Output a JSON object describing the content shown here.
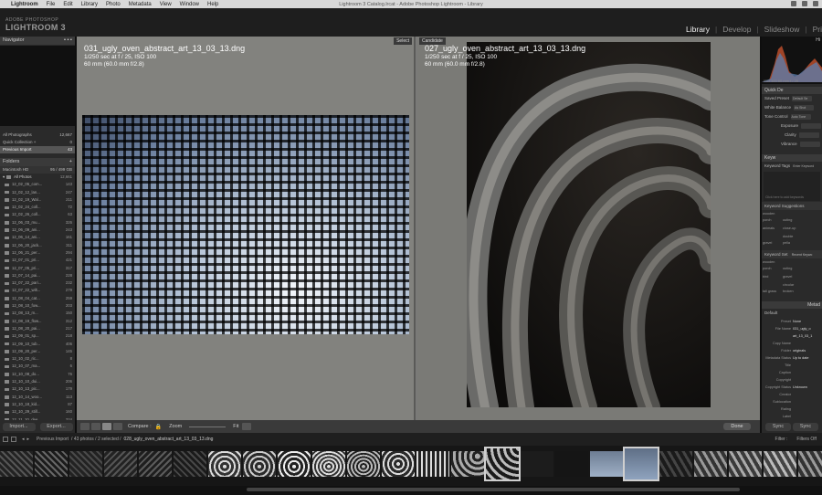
{
  "menubar": {
    "items": [
      "Lightroom",
      "File",
      "Edit",
      "Library",
      "Photo",
      "Metadata",
      "View",
      "Window",
      "Help"
    ],
    "window_title": "Lightroom 3 Catalog.lrcat - Adobe Photoshop Lightroom - Library"
  },
  "identity": {
    "brand_sub": "ADOBE PHOTOSHOP",
    "brand": "LIGHTROOM 3"
  },
  "modules": [
    "Library",
    "Develop",
    "Slideshow",
    "Pri"
  ],
  "left_panel": {
    "navigator_title": "Navigator",
    "catalog": [
      {
        "label": "All Photographs",
        "count": "12,667"
      },
      {
        "label": "Quick Collection +",
        "count": "0"
      },
      {
        "label": "Previous Import",
        "count": "43"
      }
    ],
    "folders_title": "Folders",
    "volume": {
      "label": "Macintosh HD",
      "info": "95 / 499 GB"
    },
    "root_folder": {
      "label": "All Photos",
      "count": "12,661"
    },
    "folders": [
      {
        "name": "12_02_05_com...",
        "count": "143"
      },
      {
        "name": "12_02_12_lan...",
        "count": "247"
      },
      {
        "name": "12_02_19_Wal...",
        "count": "211"
      },
      {
        "name": "12_02_24_coll...",
        "count": "72"
      },
      {
        "name": "12_02_26_coll...",
        "count": "63"
      },
      {
        "name": "12_06_03_mu...",
        "count": "326"
      },
      {
        "name": "12_06_09_ani...",
        "count": "243"
      },
      {
        "name": "12_06_14_ani...",
        "count": "161"
      },
      {
        "name": "12_06_20_jack...",
        "count": "311"
      },
      {
        "name": "12_06_21_per...",
        "count": "294"
      },
      {
        "name": "12_07_01_pri...",
        "count": "421"
      },
      {
        "name": "12_07_05_pri...",
        "count": "317"
      },
      {
        "name": "12_07_14_pai...",
        "count": "228"
      },
      {
        "name": "12_07_22_pari...",
        "count": "232"
      },
      {
        "name": "12_07_22_wilt...",
        "count": "279"
      },
      {
        "name": "12_08_04_cat...",
        "count": "259"
      },
      {
        "name": "12_08_10_fow...",
        "count": "203"
      },
      {
        "name": "12_08_13_m...",
        "count": "150"
      },
      {
        "name": "12_08_19_flow...",
        "count": "312"
      },
      {
        "name": "12_08_20_pai...",
        "count": "217"
      },
      {
        "name": "12_09_01_sp...",
        "count": "218"
      },
      {
        "name": "12_09_10_tub...",
        "count": "406"
      },
      {
        "name": "12_09_20_per...",
        "count": "145"
      },
      {
        "name": "12_10_02_ric...",
        "count": "8"
      },
      {
        "name": "12_10_07_ma...",
        "count": "6"
      },
      {
        "name": "12_10_08_do...",
        "count": "76"
      },
      {
        "name": "12_10_10_dui...",
        "count": "206"
      },
      {
        "name": "12_10_13_pic...",
        "count": "179"
      },
      {
        "name": "12_10_14_woo...",
        "count": "113"
      },
      {
        "name": "12_10_18_kid...",
        "count": "87"
      },
      {
        "name": "12_10_29_still...",
        "count": "160"
      },
      {
        "name": "12_11_10_dee...",
        "count": "324"
      },
      {
        "name": "12_11_17_but...",
        "count": "221"
      },
      {
        "name": "12_11_24_fall...",
        "count": "181"
      },
      {
        "name": "12_11_17_tub...",
        "count": "243"
      }
    ],
    "import_label": "Import...",
    "export_label": "Export..."
  },
  "compare": {
    "select_label": "Select",
    "candidate_label": "Candidate",
    "select_photo": {
      "filename": "031_ugly_oven_abstract_art_13_03_13.dng",
      "exposure": "1/250 sec at f / 25, ISO 100",
      "lens": "60 mm (60.0 mm f/2.8)"
    },
    "candidate_photo": {
      "filename": "027_ugly_oven_abstract_art_13_03_13.dng",
      "exposure": "1/250 sec at f / 25, ISO 100",
      "lens": "60 mm (60.0 mm f/2.8)"
    }
  },
  "toolbar": {
    "compare_label": "Compare :",
    "zoom_label": "Zoom",
    "fit_label": "Fit",
    "done_label": "Done"
  },
  "right_panel": {
    "histogram_title": "Hi",
    "histogram_readout": "ISO 100    60 mm    f / 25",
    "quick_develop_title": "Quick De",
    "saved_preset": {
      "label": "Saved Preset",
      "value": "Default Se"
    },
    "white_balance": {
      "label": "White Balance",
      "value": "As Shot"
    },
    "tone_control": {
      "label": "Tone Control",
      "value": "Auto Tone"
    },
    "tone_rows": [
      "Exposure",
      "Clarity",
      "Vibrance"
    ],
    "keywording_title": "Keyw",
    "keyword_tags_label": "Keyword Tags",
    "keyword_tags_value": "Enter Keyword",
    "keyword_placeholder": "Click here to add keywords",
    "keyword_suggestions_title": "Keyword Suggestions",
    "keyword_suggestions": [
      "wooden porch",
      "outing",
      "animals",
      "close-up",
      "gravel",
      "double pella"
    ],
    "keyword_set_label": "Keyword Set",
    "keyword_set_value": "Recent Keywo",
    "keyword_set": [
      "wooden porch",
      "outing",
      "bird",
      "gravel",
      "tall grass",
      "circular broken"
    ],
    "metadata_title": "Metad",
    "metadata_preset": "Default",
    "preset_label": "Preset",
    "preset_value": "None",
    "metadata_rows": [
      {
        "k": "File Name",
        "v": "031_ugly_o"
      },
      {
        "k": "",
        "v": "art_13_03_1"
      },
      {
        "k": "Copy Name",
        "v": ""
      },
      {
        "k": "Folder",
        "v": "originals"
      },
      {
        "k": "Metadata Status",
        "v": "Up to date"
      },
      {
        "k": "Title",
        "v": ""
      },
      {
        "k": "Caption",
        "v": ""
      },
      {
        "k": "Copyright",
        "v": ""
      },
      {
        "k": "Copyright Status",
        "v": "Unknown"
      },
      {
        "k": "Creator",
        "v": ""
      },
      {
        "k": "Sublocation",
        "v": ""
      },
      {
        "k": "Rating",
        "v": ""
      },
      {
        "k": "Label",
        "v": ""
      }
    ],
    "sync_label": "Sync",
    "sync_label_2": "Sync"
  },
  "filmstrip_bar": {
    "source": "Previous Import",
    "info": "/ 43 photos / 2 selected /",
    "current": "028_ugly_oven_abstract_art_13_03_13.dng",
    "filter_label": "Filter :",
    "filters_off": "Filters Off"
  }
}
